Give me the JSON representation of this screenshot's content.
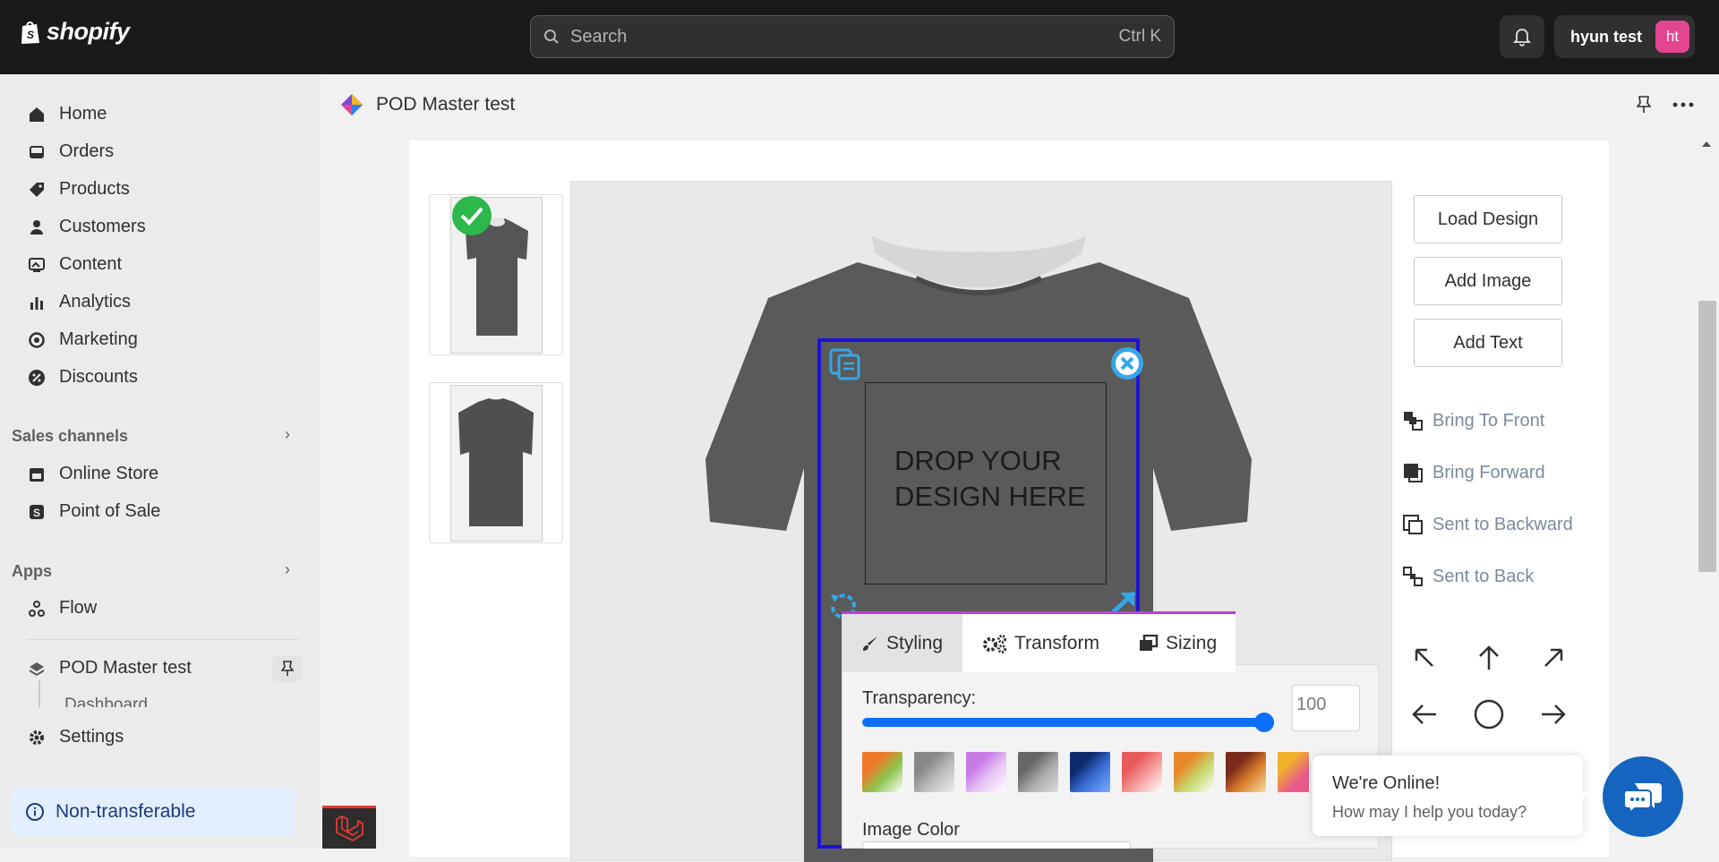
{
  "topbar": {
    "logo_text": "shopify",
    "search_placeholder": "Search",
    "search_shortcut": "Ctrl K",
    "user_name": "hyun test",
    "user_initials": "ht"
  },
  "sidebar": {
    "items": [
      {
        "label": "Home",
        "icon": "home-icon"
      },
      {
        "label": "Orders",
        "icon": "inbox-icon"
      },
      {
        "label": "Products",
        "icon": "tag-icon"
      },
      {
        "label": "Customers",
        "icon": "person-icon"
      },
      {
        "label": "Content",
        "icon": "image-icon"
      },
      {
        "label": "Analytics",
        "icon": "bar-chart-icon"
      },
      {
        "label": "Marketing",
        "icon": "target-icon"
      },
      {
        "label": "Discounts",
        "icon": "discount-icon"
      }
    ],
    "sales_channels_title": "Sales channels",
    "sales_channels": [
      {
        "label": "Online Store",
        "icon": "store-icon"
      },
      {
        "label": "Point of Sale",
        "icon": "pos-icon"
      }
    ],
    "apps_title": "Apps",
    "apps": [
      {
        "label": "Flow",
        "icon": "flow-icon"
      },
      {
        "label": "POD Master test",
        "icon": "app-icon"
      }
    ],
    "app_subitem": "Dashboard",
    "settings_label": "Settings",
    "non_transferable_label": "Non-transferable"
  },
  "app_header": {
    "title": "POD Master test"
  },
  "designer": {
    "drop_text_line1": "DROP YOUR",
    "drop_text_line2": "DESIGN HERE",
    "buttons": {
      "load_design": "Load Design",
      "add_image": "Add Image",
      "add_text": "Add Text"
    },
    "layer_actions": [
      {
        "label": "Bring To Front",
        "icon": "bring-to-front-icon"
      },
      {
        "label": "Bring Forward",
        "icon": "bring-forward-icon"
      },
      {
        "label": "Sent to Backward",
        "icon": "send-backward-icon"
      },
      {
        "label": "Sent to Back",
        "icon": "send-to-back-icon"
      }
    ],
    "tabs": [
      {
        "label": "Styling",
        "active": true
      },
      {
        "label": "Transform",
        "active": false
      },
      {
        "label": "Sizing",
        "active": false
      }
    ],
    "transparency_label": "Transparency:",
    "transparency_value": "100",
    "transparency_level": 1.0,
    "image_color_label": "Image Color"
  },
  "chat": {
    "title": "We're Online!",
    "subtitle": "How may I help you today?"
  },
  "colors": {
    "accent_blue": "#0d6efd",
    "selection_border": "#1c12d8",
    "tab_border": "#c23ce0",
    "check_green": "#2db84b",
    "chat_blue": "#1565c0"
  }
}
